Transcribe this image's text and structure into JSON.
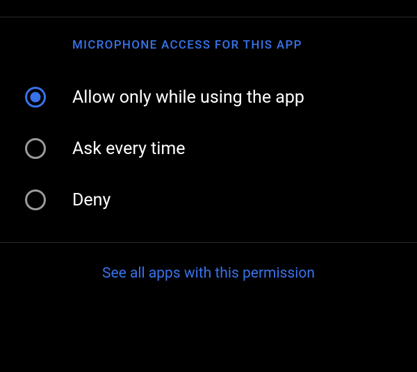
{
  "section": {
    "header": "MICROPHONE ACCESS FOR THIS APP"
  },
  "options": [
    {
      "label": "Allow only while using the app",
      "selected": true
    },
    {
      "label": "Ask every time",
      "selected": false
    },
    {
      "label": "Deny",
      "selected": false
    }
  ],
  "footer": {
    "link": "See all apps with this permission"
  }
}
